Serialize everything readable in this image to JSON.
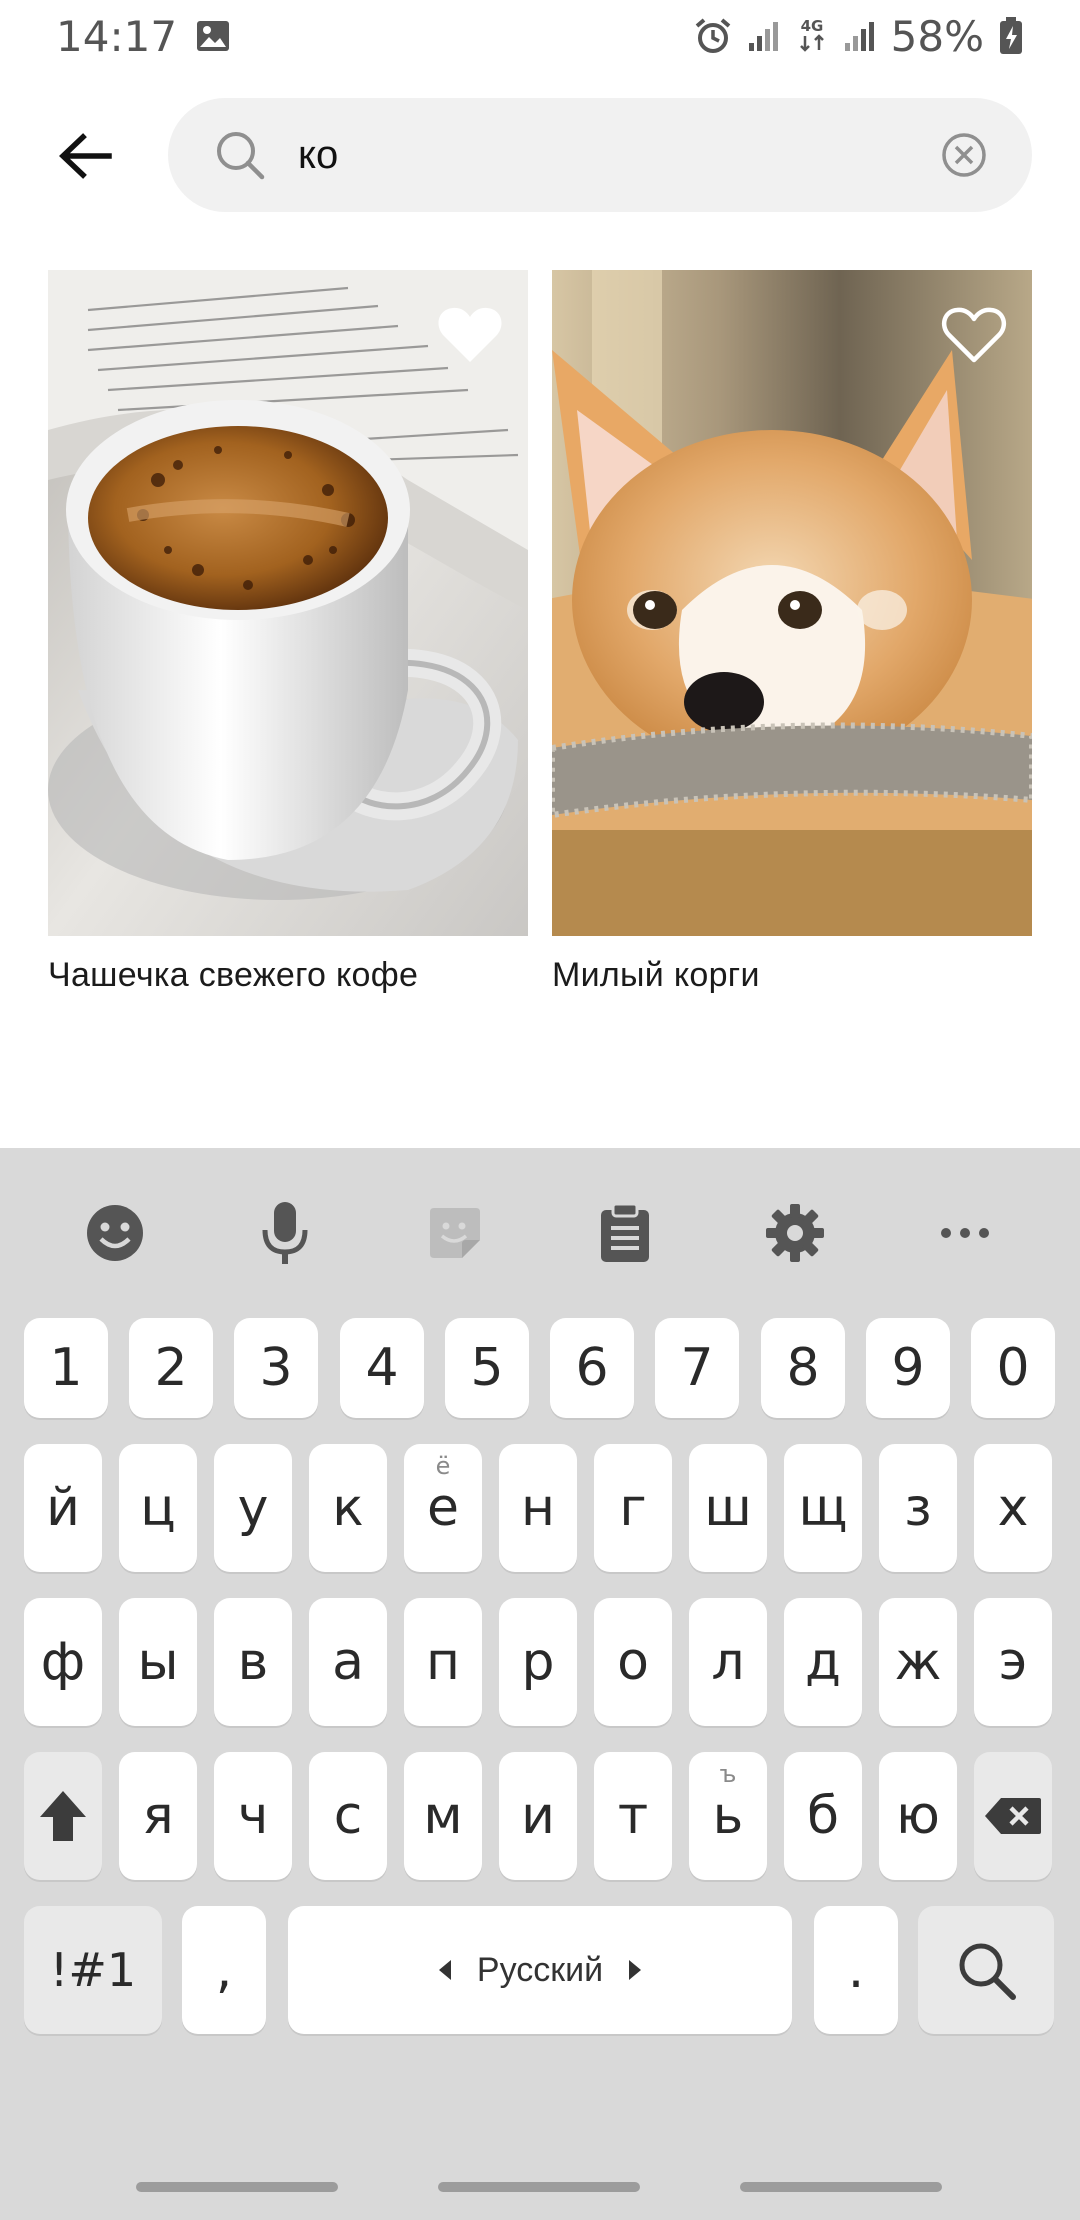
{
  "status_bar": {
    "time": "14:17",
    "network": "4G",
    "battery": "58%",
    "icons": [
      "gallery-icon",
      "alarm-icon",
      "signal-icon",
      "4g-data-icon",
      "signal-icon",
      "battery-charging-icon"
    ]
  },
  "search": {
    "query": "ко",
    "back_icon": "arrow-left-icon",
    "search_icon": "search-icon",
    "clear_icon": "clear-circle-icon"
  },
  "results": [
    {
      "title": "Чашечка свежего кофе",
      "image": "coffee-cup-book-image",
      "favorited": true
    },
    {
      "title": "Милый корги",
      "image": "corgi-dog-image",
      "favorited": false
    }
  ],
  "keyboard": {
    "toolbar": [
      "emoji-icon",
      "microphone-icon",
      "sticker-icon",
      "clipboard-icon",
      "settings-gear-icon",
      "more-icon"
    ],
    "numbers": [
      "1",
      "2",
      "3",
      "4",
      "5",
      "6",
      "7",
      "8",
      "9",
      "0"
    ],
    "row1": [
      "й",
      "ц",
      "у",
      "к",
      "е",
      "н",
      "г",
      "ш",
      "щ",
      "з",
      "х"
    ],
    "row1_hints": {
      "4": "ё"
    },
    "row2": [
      "ф",
      "ы",
      "в",
      "а",
      "п",
      "р",
      "о",
      "л",
      "д",
      "ж",
      "э"
    ],
    "row3": [
      "я",
      "ч",
      "с",
      "м",
      "и",
      "т",
      "ь",
      "б",
      "ю"
    ],
    "row3_hints": {
      "6": "ъ"
    },
    "symbols_label": "!#1",
    "comma_label": ",",
    "space_label": "Русский",
    "period_label": ".",
    "shift_icon": "shift-arrow-icon",
    "backspace_icon": "backspace-icon",
    "enter_icon": "search-icon"
  },
  "colors": {
    "search_bg": "#f1f1f1",
    "keyboard_bg": "#d9d9d9",
    "key_bg": "#ffffff",
    "text": "#1b1b1b"
  }
}
